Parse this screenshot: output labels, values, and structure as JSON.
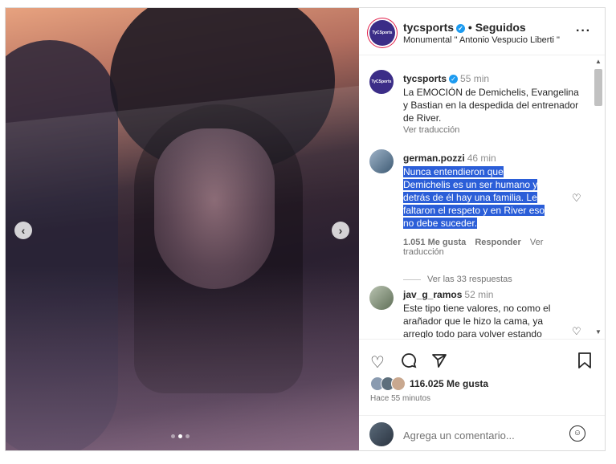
{
  "post": {
    "username": "tycsports",
    "follow_status": "• Seguidos",
    "location": "Monumental \" Antonio Vespucio Liberti \"",
    "avatar_text": "TyCSports",
    "caption_time": "55 min",
    "caption": "La EMOCIÓN de Demichelis, Evangelina y Bastian en la despedida del entrenador de River.",
    "translate": "Ver traducción"
  },
  "comments": [
    {
      "username": "german.pozzi",
      "time": "46 min",
      "text": "Nunca entendieron que Demichelis es un ser humano y detrás de él hay una familia. Le faltaron el respeto y en River eso no debe suceder.",
      "likes": "1.051 Me gusta",
      "reply": "Responder",
      "translate": "Ver traducción",
      "replies": "Ver las 33 respuestas"
    },
    {
      "username": "jav_g_ramos",
      "time": "52 min",
      "text": "Este tipo tiene valores, no como el arañador que le hizo la cama, ya arreglo todo para volver estando"
    }
  ],
  "actions": {
    "likes": "116.025 Me gusta",
    "ago": "Hace 55 minutos",
    "comment_placeholder": "Agrega un comentario..."
  },
  "carousel": {
    "current_slide": 2,
    "total_slides": 3
  },
  "icons": [
    "heart-icon",
    "comment-icon",
    "share-icon",
    "bookmark-icon",
    "emoji-icon",
    "more-icon",
    "chevron-left-icon",
    "chevron-right-icon",
    "verified-icon"
  ],
  "colors": {
    "highlight": "#2b5ed8",
    "verified": "#1d9bf0",
    "brand": "#3b2d87"
  }
}
